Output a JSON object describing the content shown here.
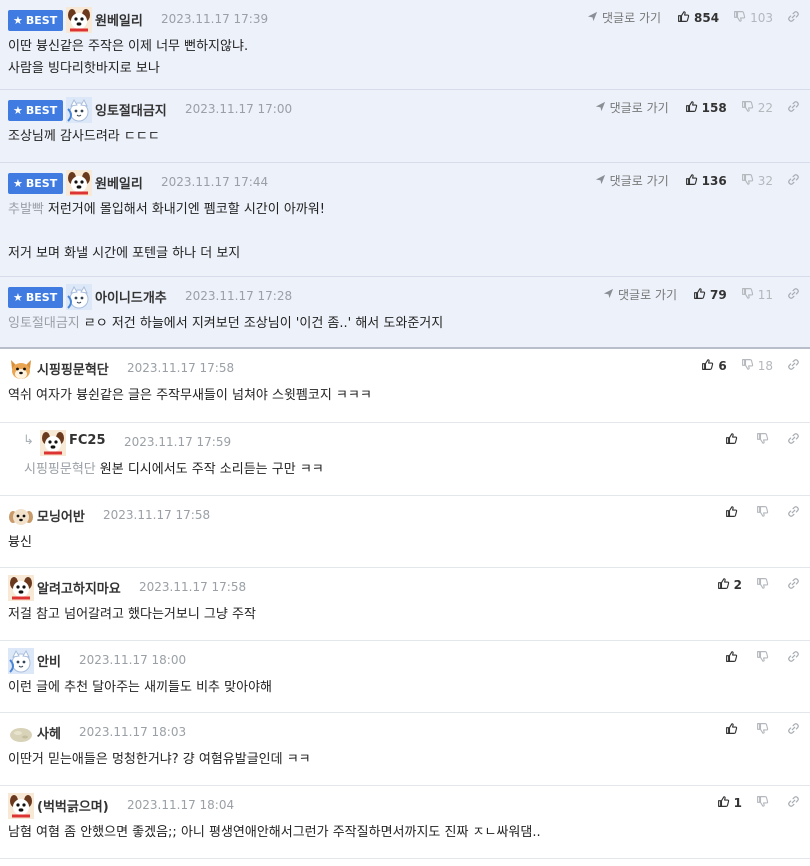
{
  "labels": {
    "best": "BEST",
    "reply_link": "댓글로 가기"
  },
  "colors": {
    "best_badge": "#3f7be0",
    "best_row_bg": "#edf1fa",
    "divider": "#e3e6ea"
  },
  "comments": [
    {
      "best": true,
      "avatar": "dog-avatar-red",
      "nick": "원베일리",
      "date": "2023.11.17 17:39",
      "likes": "854",
      "dislikes": "103",
      "mention": "",
      "text": "이딴 븅신같은 주작은 이제 너무 뻔하지않냐.\n사람을 빙다리핫바지로 보나"
    },
    {
      "best": true,
      "avatar": "cat-avatar-blue",
      "nick": "잉토절대금지",
      "date": "2023.11.17 17:00",
      "likes": "158",
      "dislikes": "22",
      "mention": "",
      "text": "조상님께 감사드려라 ㄷㄷㄷ"
    },
    {
      "best": true,
      "avatar": "dog-avatar-red",
      "nick": "원베일리",
      "date": "2023.11.17 17:44",
      "likes": "136",
      "dislikes": "32",
      "mention": "추발빡",
      "text": "저런거에 몰입해서 화내기엔 펨코할 시간이 아까워!\n\n저거 보며 화낼 시간에 포텐글 하나 더 보지"
    },
    {
      "best": true,
      "avatar": "cat-avatar-blue",
      "nick": "아이니드개추",
      "date": "2023.11.17 17:28",
      "likes": "79",
      "dislikes": "11",
      "mention": "잉토절대금지",
      "text": "ㄹㅇ 저건 하늘에서 지켜보던 조상님이 '이건 좀..' 해서 도와준거지"
    },
    {
      "best": false,
      "avatar": "shiba-avatar",
      "nick": "시핑핑문혁단",
      "date": "2023.11.17 17:58",
      "likes": "6",
      "dislikes": "18",
      "mention": "",
      "text": "역쉬 여자가 븅쉰같은 글은 주작무새들이 넘쳐야 스윗펨코지 ㅋㅋㅋ"
    },
    {
      "best": false,
      "reply": true,
      "avatar": "dog-avatar-red",
      "nick": "FC25",
      "date": "2023.11.17 17:59",
      "likes": "",
      "dislikes": "",
      "mention": "시핑핑문혁단",
      "text": "원본 디시에서도 주작 소리듣는 구만 ㅋㅋ"
    },
    {
      "best": false,
      "avatar": "puppy-avatar",
      "nick": "모닝어반",
      "date": "2023.11.17 17:58",
      "likes": "",
      "dislikes": "",
      "mention": "",
      "text": "븅신"
    },
    {
      "best": false,
      "avatar": "dog-avatar-red",
      "nick": "알려고하지마요",
      "date": "2023.11.17 17:58",
      "likes": "2",
      "dislikes": "",
      "mention": "",
      "text": "저걸 참고 넘어갈려고 했다는거보니 그냥 주작"
    },
    {
      "best": false,
      "avatar": "cat-avatar-blue",
      "nick": "안비",
      "date": "2023.11.17 18:00",
      "likes": "",
      "dislikes": "",
      "mention": "",
      "text": "이런 글에 추천 달아주는 새끼들도 비추 맞아야해"
    },
    {
      "best": false,
      "avatar": "rock-avatar",
      "nick": "사헤",
      "date": "2023.11.17 18:03",
      "likes": "",
      "dislikes": "",
      "mention": "",
      "text": "이딴거 믿는애들은 멍청한거냐? 걍 여혐유발글인데 ㅋㅋ"
    },
    {
      "best": false,
      "avatar": "dog-avatar-red",
      "nick": "(벅벅긁으며)",
      "date": "2023.11.17 18:04",
      "likes": "1",
      "dislikes": "",
      "mention": "",
      "text": "남혐 여혐 좀 안했으면 좋겠음;; 아니 평생연애안해서그런가 주작질하면서까지도 진짜 ㅈㄴ싸워댐.."
    }
  ]
}
